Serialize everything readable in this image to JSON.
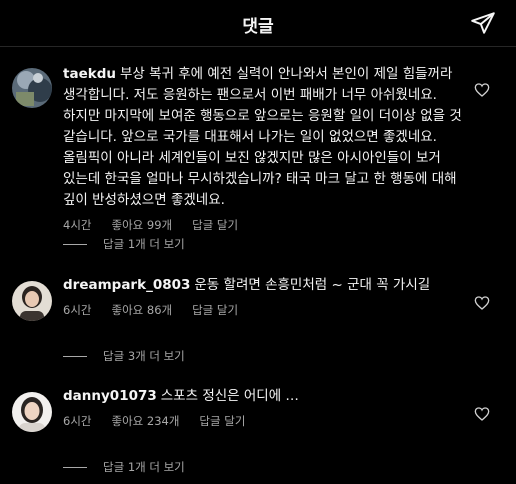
{
  "header": {
    "title": "댓글",
    "send_icon": "paper-plane-icon"
  },
  "comments": [
    {
      "username": "taekdu",
      "text": "부상 복귀 후에 예전 실력이 안나와서 본인이 제일 힘들꺼라 생각합니다. 저도 응원하는 팬으로서 이번 패배가 너무 아쉬웠네요. 하지만 마지막에 보여준 행동으로 앞으로는 응원할 일이 더이상 없을 것 같습니다. 앞으로 국가를 대표해서 나가는 일이 없었으면 좋겠네요. 올림픽이 아니라 세계인들이 보진 않겠지만 많은 아시아인들이 보거 있는데 한국을 얼마나 무시하겠습니까? 태국 마크 달고 한 행동에 대해 깊이 반성하셨으면 좋겠네요.",
      "time": "4시간",
      "likes": "좋아요 99개",
      "reply": "답글 달기",
      "view_replies": "답글 1개 더 보기"
    },
    {
      "username": "dreampark_0803",
      "text": "운동 할려면 손흥민처럼 ~ 군대 꼭 가시길",
      "time": "6시간",
      "likes": "좋아요 86개",
      "reply": "답글 달기",
      "view_replies": "답글 3개 더 보기"
    },
    {
      "username": "danny01073",
      "text": "스포츠 정신은 어디에 …",
      "time": "6시간",
      "likes": "좋아요 234개",
      "reply": "답글 달기",
      "view_replies": "답글 1개 더 보기"
    }
  ]
}
